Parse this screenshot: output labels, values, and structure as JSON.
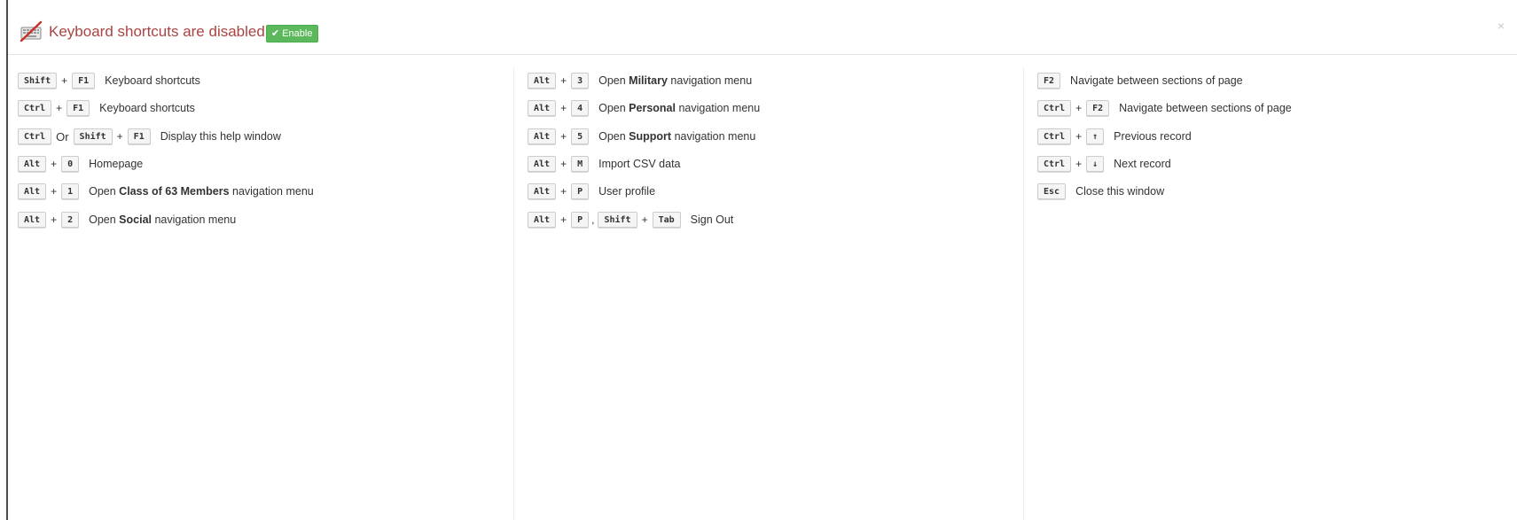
{
  "header": {
    "title": "Keyboard shortcuts are disabled",
    "enable_label": "Enable",
    "close_glyph": "×",
    "title_color": "#a94442",
    "enable_color": "#5cb85c"
  },
  "columns": [
    {
      "rows": [
        {
          "keys": [
            "Shift",
            "+",
            "F1"
          ],
          "desc_pre": "Keyboard shortcuts",
          "desc_bold": "",
          "desc_post": ""
        },
        {
          "keys": [
            "Ctrl",
            "+",
            "F1"
          ],
          "desc_pre": "Keyboard shortcuts",
          "desc_bold": "",
          "desc_post": ""
        },
        {
          "keys": [
            "Ctrl",
            "Or",
            "Shift",
            "+",
            "F1"
          ],
          "desc_pre": "Display this help window",
          "desc_bold": "",
          "desc_post": ""
        },
        {
          "keys": [
            "Alt",
            "+",
            "0"
          ],
          "desc_pre": "Homepage",
          "desc_bold": "",
          "desc_post": ""
        },
        {
          "keys": [
            "Alt",
            "+",
            "1"
          ],
          "desc_pre": "Open ",
          "desc_bold": "Class of 63 Members",
          "desc_post": " navigation menu"
        },
        {
          "keys": [
            "Alt",
            "+",
            "2"
          ],
          "desc_pre": "Open ",
          "desc_bold": "Social",
          "desc_post": " navigation menu"
        }
      ]
    },
    {
      "rows": [
        {
          "keys": [
            "Alt",
            "+",
            "3"
          ],
          "desc_pre": "Open ",
          "desc_bold": "Military",
          "desc_post": " navigation menu"
        },
        {
          "keys": [
            "Alt",
            "+",
            "4"
          ],
          "desc_pre": "Open ",
          "desc_bold": "Personal",
          "desc_post": " navigation menu"
        },
        {
          "keys": [
            "Alt",
            "+",
            "5"
          ],
          "desc_pre": "Open ",
          "desc_bold": "Support",
          "desc_post": " navigation menu"
        },
        {
          "keys": [
            "Alt",
            "+",
            "M"
          ],
          "desc_pre": "Import CSV data",
          "desc_bold": "",
          "desc_post": ""
        },
        {
          "keys": [
            "Alt",
            "+",
            "P"
          ],
          "desc_pre": "User profile",
          "desc_bold": "",
          "desc_post": ""
        },
        {
          "keys": [
            "Alt",
            "+",
            "P",
            ",",
            "Shift",
            "+",
            "Tab"
          ],
          "desc_pre": "Sign Out",
          "desc_bold": "",
          "desc_post": ""
        }
      ]
    },
    {
      "rows": [
        {
          "keys": [
            "F2"
          ],
          "desc_pre": "Navigate between sections of page",
          "desc_bold": "",
          "desc_post": ""
        },
        {
          "keys": [
            "Ctrl",
            "+",
            "F2"
          ],
          "desc_pre": "Navigate between sections of page",
          "desc_bold": "",
          "desc_post": ""
        },
        {
          "keys": [
            "Ctrl",
            "+",
            "↑"
          ],
          "desc_pre": "Previous record",
          "desc_bold": "",
          "desc_post": ""
        },
        {
          "keys": [
            "Ctrl",
            "+",
            "↓"
          ],
          "desc_pre": "Next record",
          "desc_bold": "",
          "desc_post": ""
        },
        {
          "keys": [
            "Esc"
          ],
          "desc_pre": "Close this window",
          "desc_bold": "",
          "desc_post": ""
        }
      ]
    }
  ]
}
